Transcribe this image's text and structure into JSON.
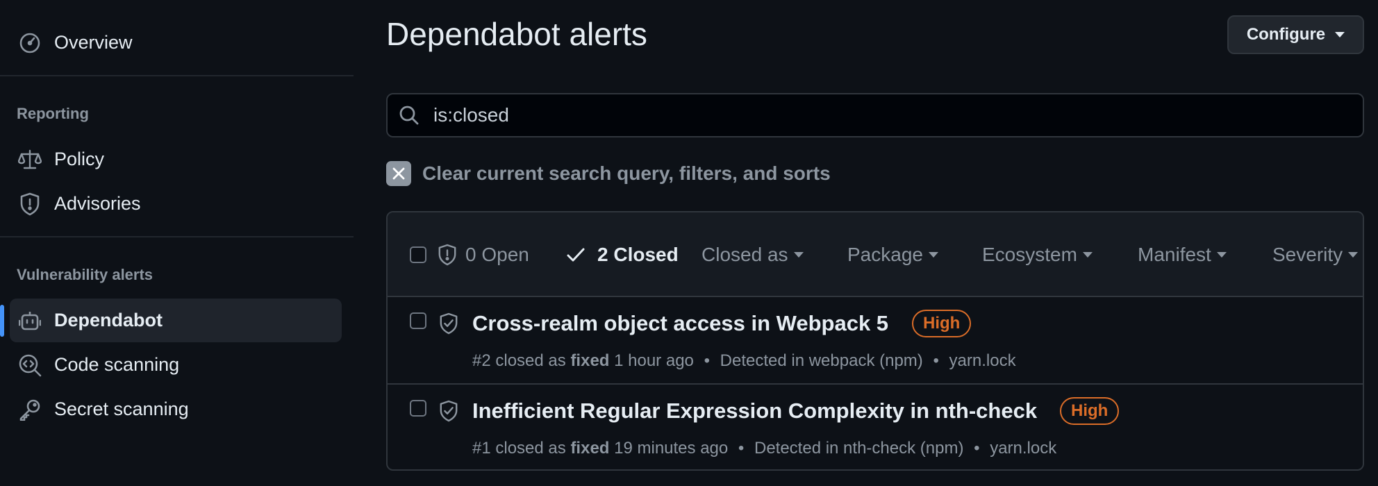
{
  "sidebar": {
    "overview": "Overview",
    "reporting_heading": "Reporting",
    "policy": "Policy",
    "advisories": "Advisories",
    "vuln_heading": "Vulnerability alerts",
    "dependabot": "Dependabot",
    "code_scanning": "Code scanning",
    "secret_scanning": "Secret scanning"
  },
  "header": {
    "title": "Dependabot alerts",
    "configure_label": "Configure"
  },
  "search": {
    "value": "is:closed"
  },
  "clear": {
    "label": "Clear current search query, filters, and sorts"
  },
  "filters": {
    "open": "0 Open",
    "closed": "2 Closed",
    "closed_as": "Closed as",
    "package": "Package",
    "ecosystem": "Ecosystem",
    "manifest": "Manifest",
    "severity": "Severity"
  },
  "alerts": [
    {
      "title": "Cross-realm object access in Webpack 5",
      "severity": "High",
      "number": "#2",
      "closed_as_prefix": "closed as",
      "reason": "fixed",
      "time": "1 hour ago",
      "detected": "Detected in webpack (npm)",
      "manifest": "yarn.lock"
    },
    {
      "title": "Inefficient Regular Expression Complexity in nth-check",
      "severity": "High",
      "number": "#1",
      "closed_as_prefix": "closed as",
      "reason": "fixed",
      "time": "19 minutes ago",
      "detected": "Detected in nth-check (npm)",
      "manifest": "yarn.lock"
    }
  ],
  "colors": {
    "background": "#0d1117",
    "accent": "#4493f8",
    "severity_high": "#db6d28",
    "muted": "#8d96a0"
  }
}
